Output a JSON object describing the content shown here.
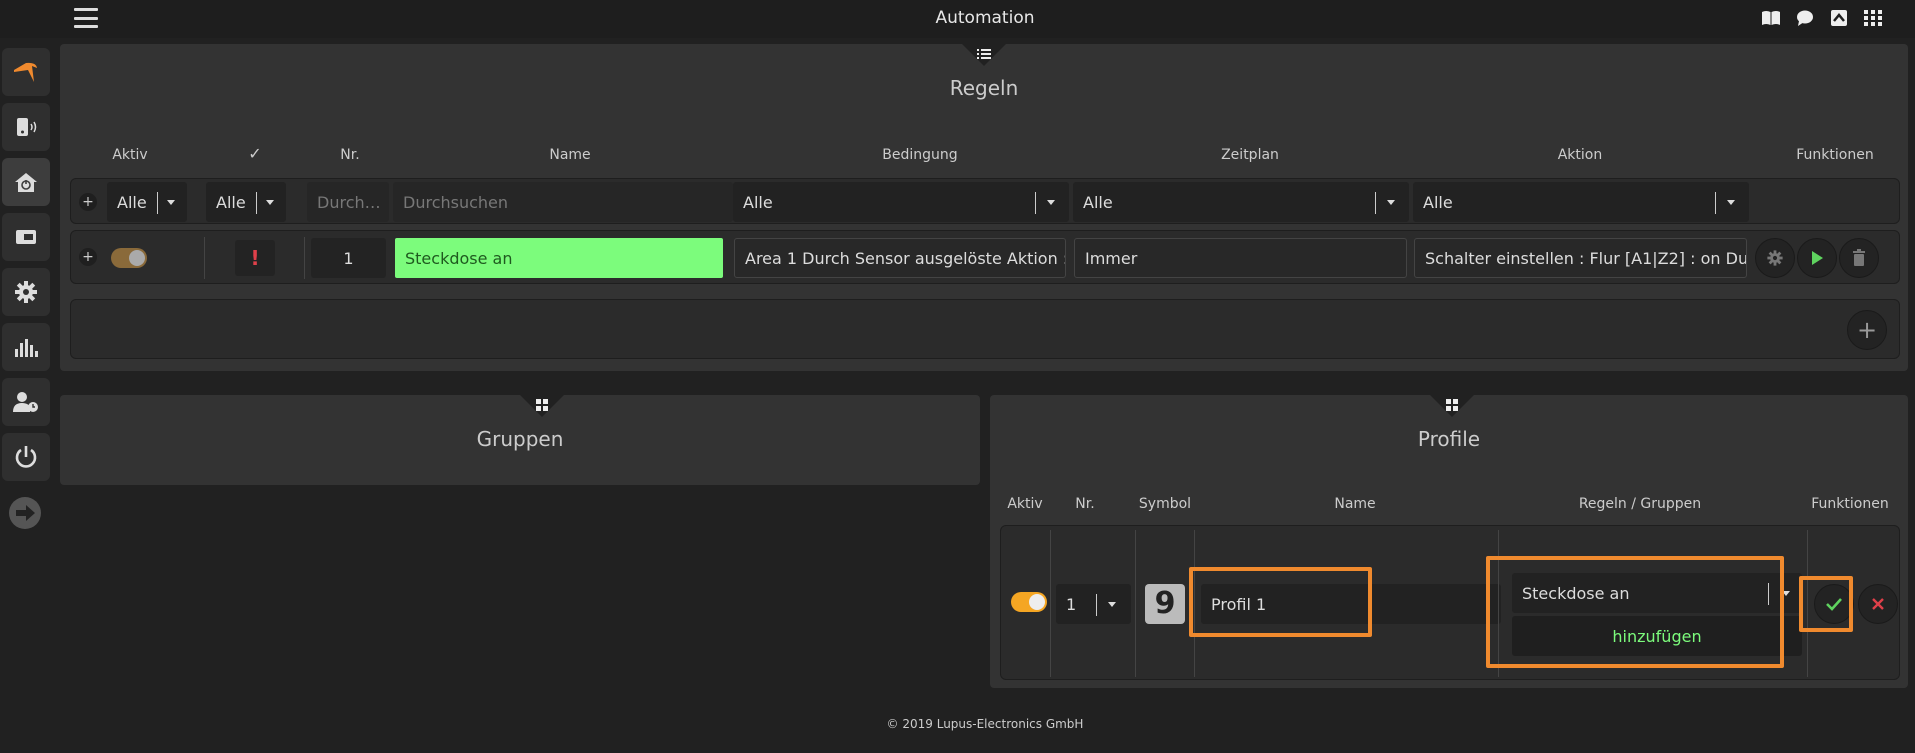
{
  "app": {
    "title": "Automation"
  },
  "topbar": {
    "icons": [
      "book-icon",
      "chat-icon",
      "collapse-icon",
      "apps-grid-icon"
    ]
  },
  "sidebar": {
    "items": [
      "logo-icon",
      "device-icon",
      "home-icon",
      "keypad-icon",
      "gear-icon",
      "chart-icon",
      "user-clock-icon",
      "power-icon",
      "arrow-right-icon"
    ]
  },
  "regeln": {
    "title": "Regeln",
    "headers": {
      "aktiv": "Aktiv",
      "nr": "Nr.",
      "name": "Name",
      "bedingung": "Bedingung",
      "zeitplan": "Zeitplan",
      "aktion": "Aktion",
      "funktionen": "Funktionen"
    },
    "filters": {
      "aktiv": "Alle",
      "check": "Alle",
      "nr_placeholder": "Durch…",
      "name_placeholder": "Durchsuchen",
      "bedingung": "Alle",
      "zeitplan": "Alle",
      "aktion": "Alle"
    },
    "rows": [
      {
        "warning": "!",
        "nr": "1",
        "name": "Steckdose an",
        "bedingung": "Area 1 Durch Sensor ausgelöste Aktion : …",
        "zeitplan": "Immer",
        "aktion": "Schalter einstellen : Flur [A1|Z2] : on Dur…",
        "active": false
      }
    ]
  },
  "gruppen": {
    "title": "Gruppen"
  },
  "profile": {
    "title": "Profile",
    "headers": {
      "aktiv": "Aktiv",
      "nr": "Nr.",
      "symbol": "Symbol",
      "name": "Name",
      "regeln_gruppen": "Regeln / Gruppen",
      "funktionen": "Funktionen"
    },
    "row": {
      "active": true,
      "nr": "1",
      "symbol": "9",
      "name": "Profil 1",
      "rule_select": "Steckdose an",
      "add_label": "hinzufügen"
    }
  },
  "colors": {
    "accent": "#f08a2e",
    "success": "#7cfc7c",
    "danger": "#e0404a"
  },
  "footer": {
    "text": "© 2019 Lupus-Electronics GmbH"
  }
}
